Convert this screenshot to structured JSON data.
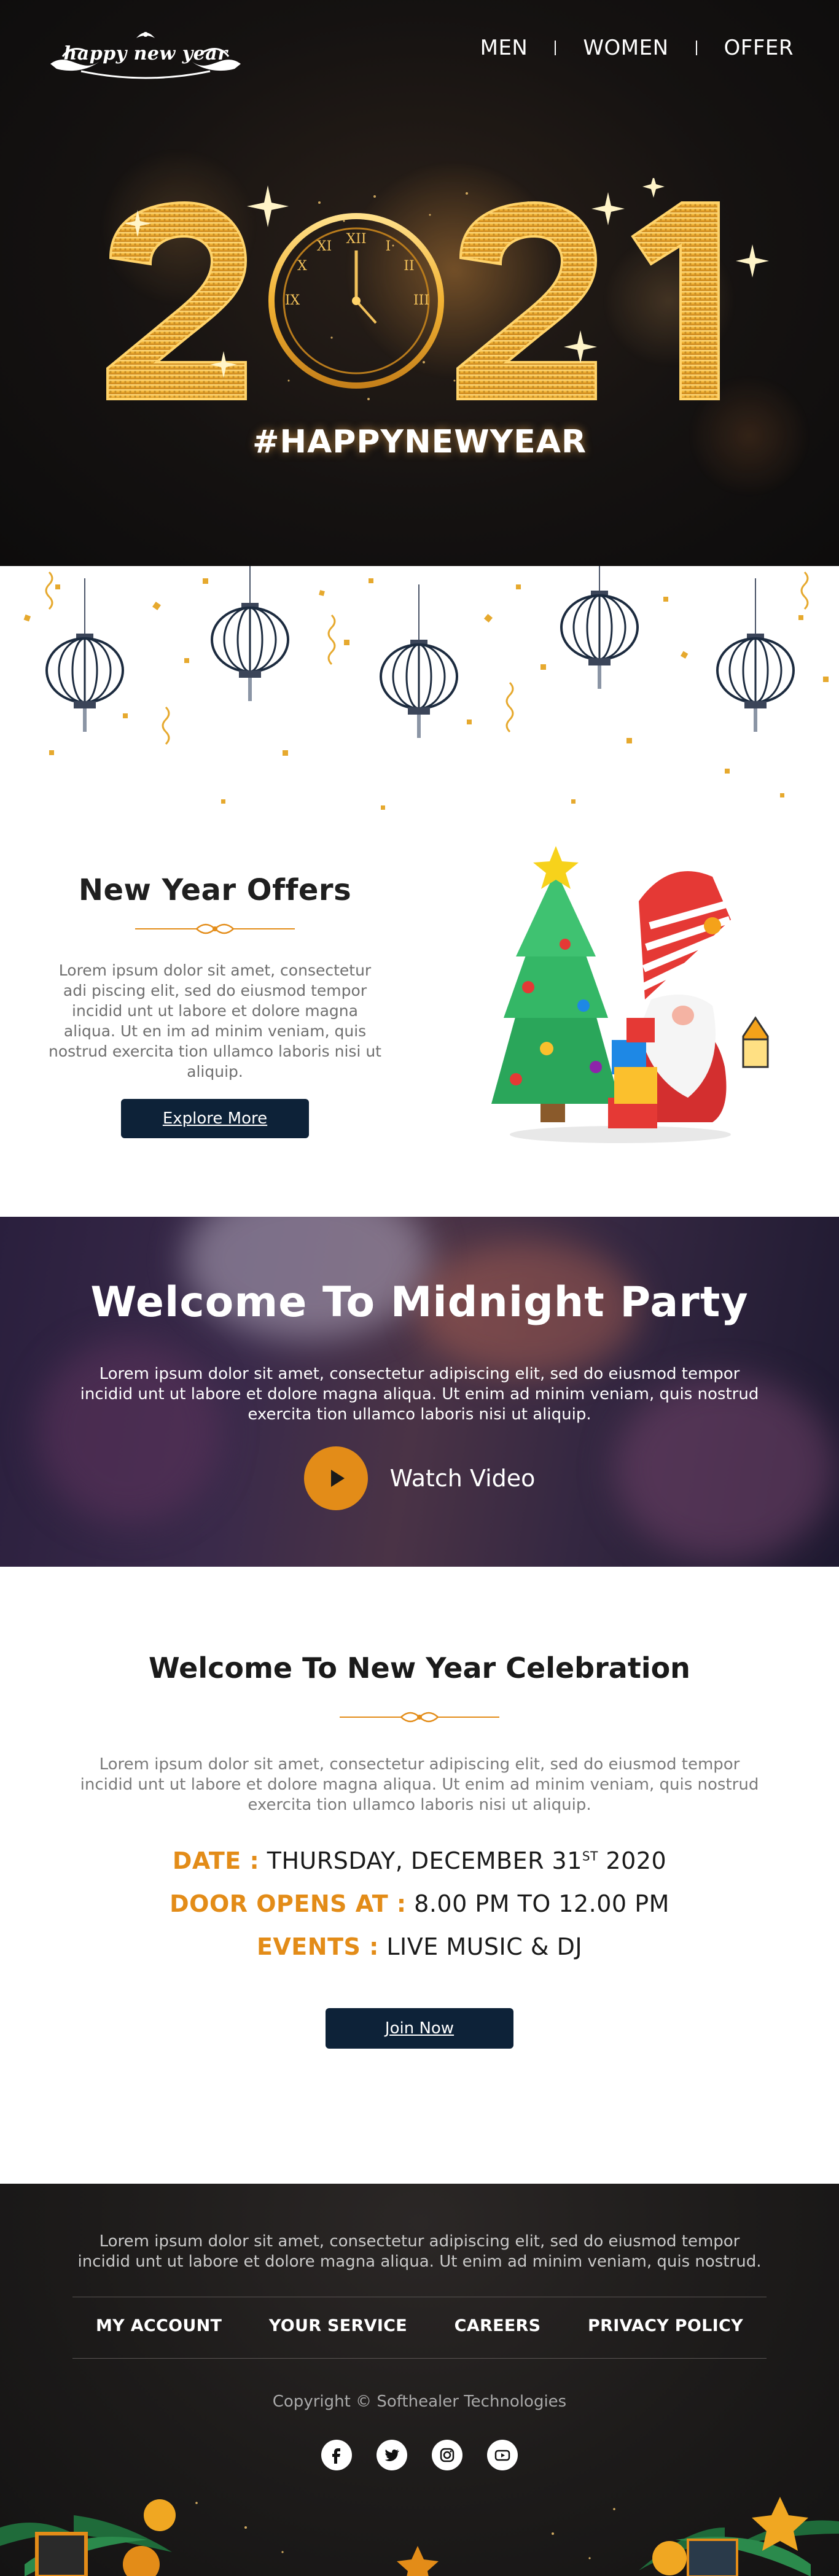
{
  "header": {
    "logo_text": "happy new year",
    "nav": [
      {
        "label": "MEN"
      },
      {
        "label": "WOMEN"
      },
      {
        "label": "OFFER"
      }
    ]
  },
  "hero": {
    "year": "2021",
    "hashtag": "#HAPPYNEWYEAR",
    "colors": {
      "gold": "#f2b233",
      "bright_gold": "#ffd36a",
      "background": "#151211"
    }
  },
  "offers": {
    "title": "New Year Offers",
    "description": "Lorem ipsum dolor sit amet, consectetur adi piscing elit, sed do eiusmod tempor incidid unt ut labore et dolore magna aliqua. Ut en im ad minim veniam, quis nostrud exercita tion ullamco laboris nisi ut aliquip.",
    "button_label": "Explore More"
  },
  "party": {
    "title": "Welcome To Midnight Party",
    "description": "Lorem ipsum dolor sit amet, consectetur adipiscing elit, sed do eiusmod tempor incidid unt ut labore et dolore magna aliqua. Ut enim ad minim veniam, quis nostrud exercita tion ullamco laboris nisi ut aliquip.",
    "watch_label": "Watch Video"
  },
  "celebration": {
    "title": "Welcome To New Year Celebration",
    "description": "Lorem ipsum dolor sit amet, consectetur adipiscing elit, sed do eiusmod tempor incidid unt ut labore et dolore magna aliqua. Ut enim ad minim veniam, quis nostrud exercita tion ullamco laboris nisi ut aliquip.",
    "date_key": "DATE :",
    "date_value_pre": "THURSDAY, DECEMBER 31",
    "date_value_sup": "ST",
    "date_value_post": " 2020",
    "doors_key": "DOOR OPENS AT :",
    "doors_value": "8.00 PM TO 12.00 PM",
    "events_key": "EVENTS :",
    "events_value": "LIVE MUSIC & DJ",
    "button_label": "Join Now",
    "accent_color": "#e38c18"
  },
  "footer": {
    "description": "Lorem ipsum dolor sit amet, consectetur adipiscing elit, sed do eiusmod tempor incidid unt ut labore et dolore magna aliqua. Ut enim ad minim veniam, quis nostrud.",
    "links": [
      {
        "label": "MY ACCOUNT"
      },
      {
        "label": "YOUR SERVICE"
      },
      {
        "label": "CAREERS"
      },
      {
        "label": "PRIVACY POLICY"
      }
    ],
    "copyright": "Copyright © Softhealer Technologies",
    "socials": [
      "facebook-icon",
      "twitter-icon",
      "instagram-icon",
      "youtube-icon"
    ]
  }
}
